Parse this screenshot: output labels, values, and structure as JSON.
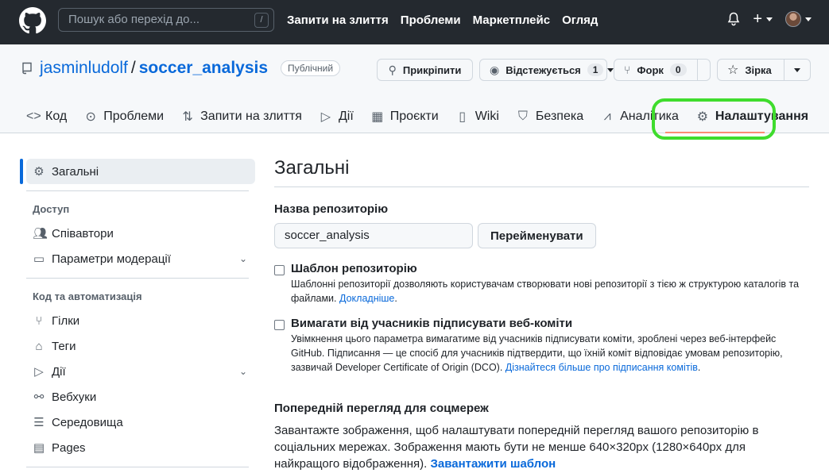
{
  "topbar": {
    "logo_icon": "github-mark-icon",
    "search_placeholder": "Пошук або перехід до...",
    "search_shortcut": "/",
    "nav": [
      "Запити на злиття",
      "Проблеми",
      "Маркетплейс",
      "Огляд"
    ]
  },
  "repo": {
    "owner": "jasminludolf",
    "separator": "/",
    "name": "soccer_analysis",
    "visibility": "Публічний",
    "pin_label": "Прикріпити",
    "watch_label": "Відстежується",
    "watch_count": "1",
    "fork_label": "Форк",
    "fork_count": "0",
    "star_label": "Зірка"
  },
  "tabs": [
    {
      "label": "Код",
      "icon": "code-icon"
    },
    {
      "label": "Проблеми",
      "icon": "issue-icon"
    },
    {
      "label": "Запити на злиття",
      "icon": "pull-request-icon"
    },
    {
      "label": "Дії",
      "icon": "play-icon"
    },
    {
      "label": "Проєкти",
      "icon": "table-icon"
    },
    {
      "label": "Wiki",
      "icon": "book-icon"
    },
    {
      "label": "Безпека",
      "icon": "shield-icon"
    },
    {
      "label": "Аналітика",
      "icon": "graph-icon"
    },
    {
      "label": "Налаштування",
      "icon": "gear-icon",
      "active": true
    }
  ],
  "sidebar": {
    "general": "Загальні",
    "access_heading": "Доступ",
    "collaborators": "Співавтори",
    "moderation": "Параметри модерації",
    "code_heading": "Код та автоматизація",
    "branches": "Гілки",
    "tags": "Теги",
    "actions": "Дії",
    "webhooks": "Вебхуки",
    "environments": "Середовища",
    "pages": "Pages"
  },
  "main": {
    "title": "Загальні",
    "repo_name_label": "Назва репозиторію",
    "repo_name_value": "soccer_analysis",
    "rename_button": "Перейменувати",
    "template_title": "Шаблон репозиторію",
    "template_desc": "Шаблонні репозиторії дозволяють користувачам створювати нові репозиторії з тією ж структурою каталогів та файлами.",
    "template_link": "Докладніше",
    "signoff_title": "Вимагати від учасників підписувати веб-коміти",
    "signoff_desc": "Увімкнення цього параметра вимагатиме від учасників підписувати коміти, зроблені через веб-інтерфейс GitHub. Підписання — це спосіб для учасників підтвердити, що їхній коміт відповідає умовам репозиторію, зазвичай Developer Certificate of Origin (DCO).",
    "signoff_link": "Дізнайтеся більше про підписання комітів",
    "social_title": "Попередній перегляд для соцмереж",
    "social_desc": "Завантажте зображення, щоб налаштувати попередній перегляд вашого репозиторію в соціальних мережах. Зображення мають бути не менше 640×320px (1280×640px для найкращого відображення).",
    "social_link": "Завантажити шаблон"
  },
  "colors": {
    "topbar": "#24292f",
    "link": "#0969da",
    "highlight": "#3fdc2d",
    "tab_underline": "#fd8c73"
  }
}
